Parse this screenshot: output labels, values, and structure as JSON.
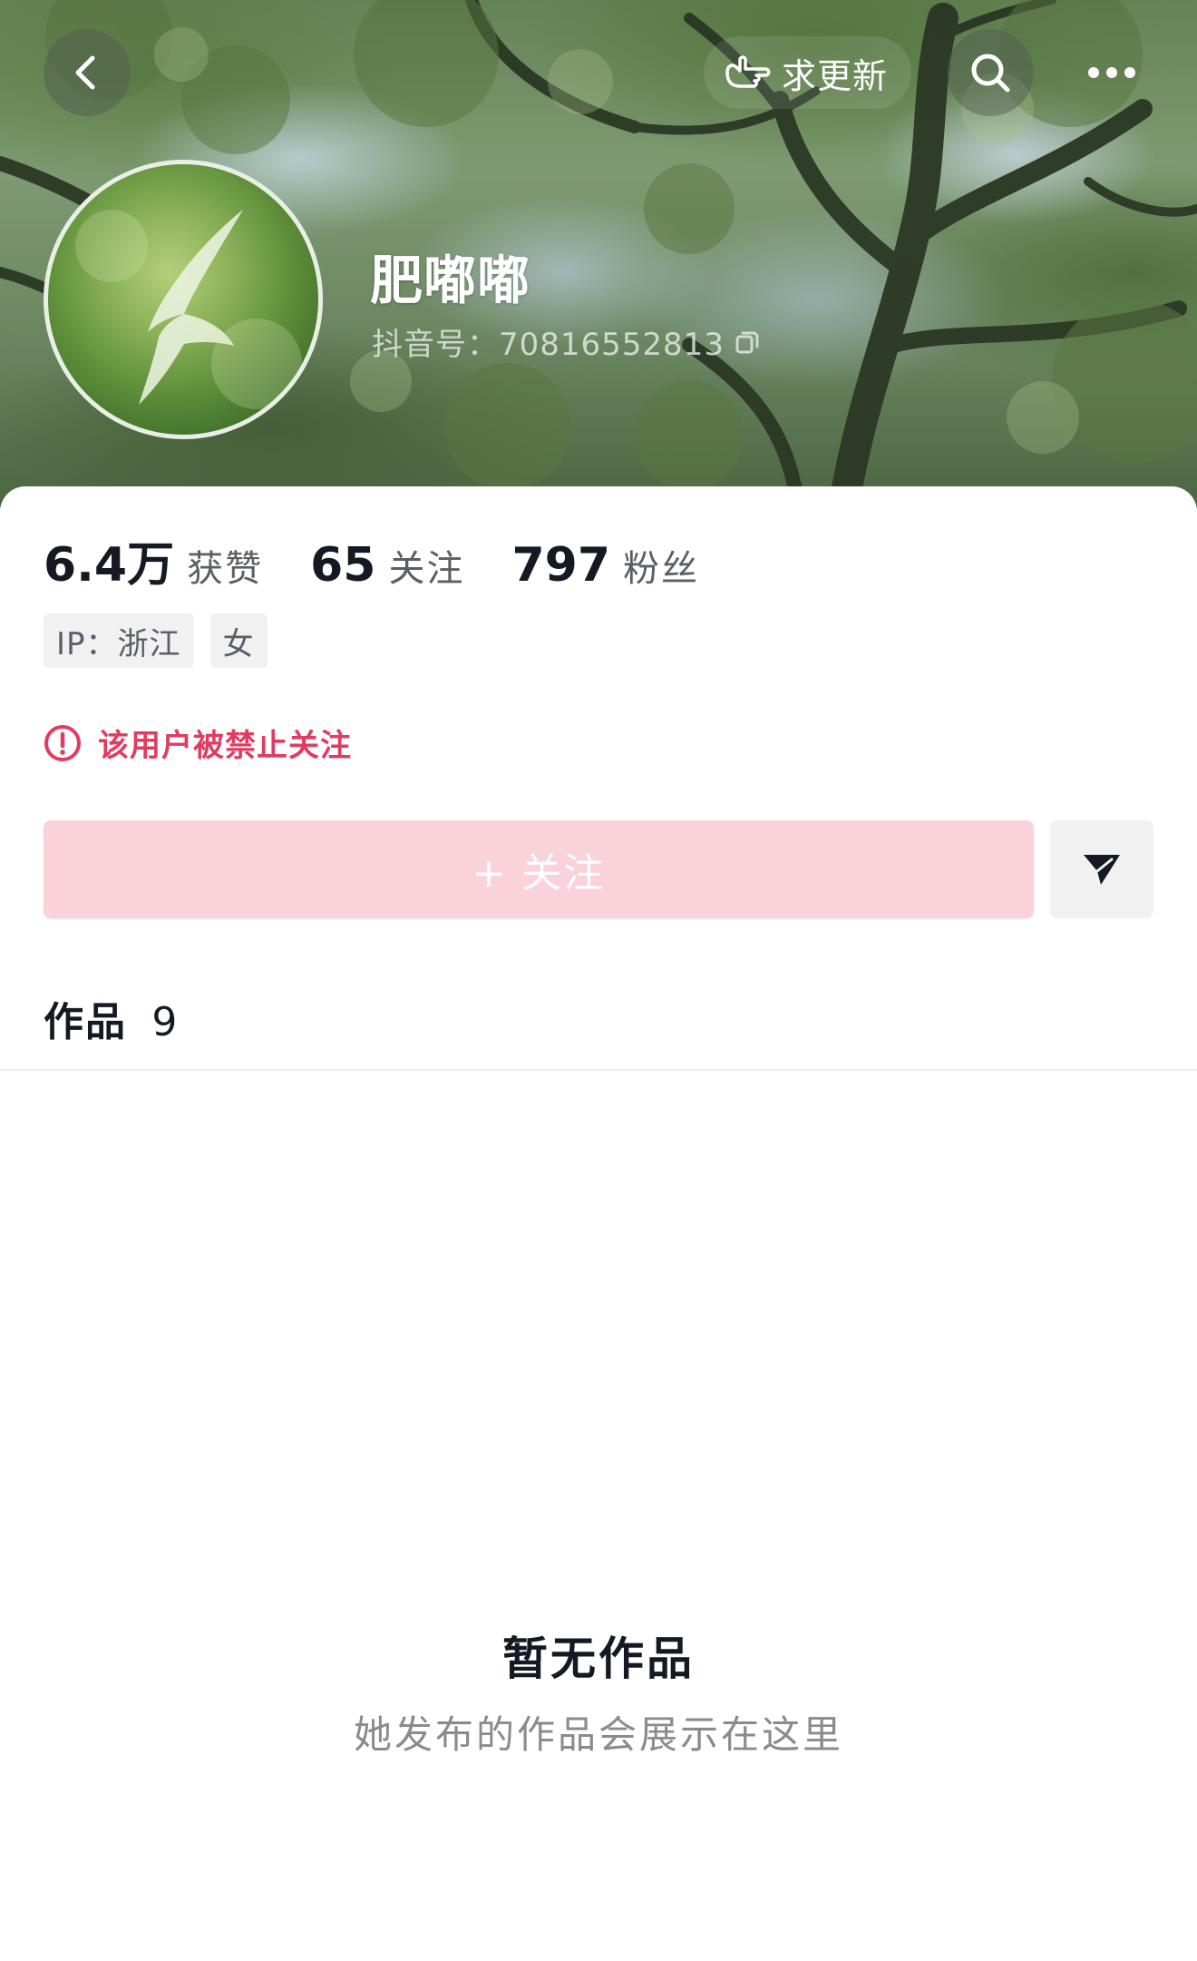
{
  "header": {
    "request_update_label": "求更新"
  },
  "profile": {
    "name": "肥嘟嘟",
    "account_id": "抖音号：70816552813"
  },
  "stats": [
    {
      "value": "6.4万",
      "label": "获赞"
    },
    {
      "value": "65",
      "label": "关注"
    },
    {
      "value": "797",
      "label": "粉丝"
    }
  ],
  "tags": [
    {
      "text": "IP：浙江"
    },
    {
      "text": "女"
    }
  ],
  "warning": {
    "text": "该用户被禁止关注"
  },
  "actions": {
    "follow_label": "+ 关注"
  },
  "works": {
    "tab_label": "作品",
    "count": "9"
  },
  "empty_state": {
    "title": "暂无作品",
    "subtitle": "她发布的作品会展示在这里"
  },
  "colors": {
    "warning": "#e33a60",
    "follow_button_bg": "#f9d2da",
    "primary_text": "#161823",
    "secondary_text": "#5c5e66"
  },
  "icons": {
    "back": "chevron-left-icon",
    "request_update": "hand-pointing-icon",
    "search": "search-icon",
    "more": "more-dots-icon",
    "copy": "copy-icon",
    "warning": "alert-circle-icon",
    "share": "send-icon"
  }
}
